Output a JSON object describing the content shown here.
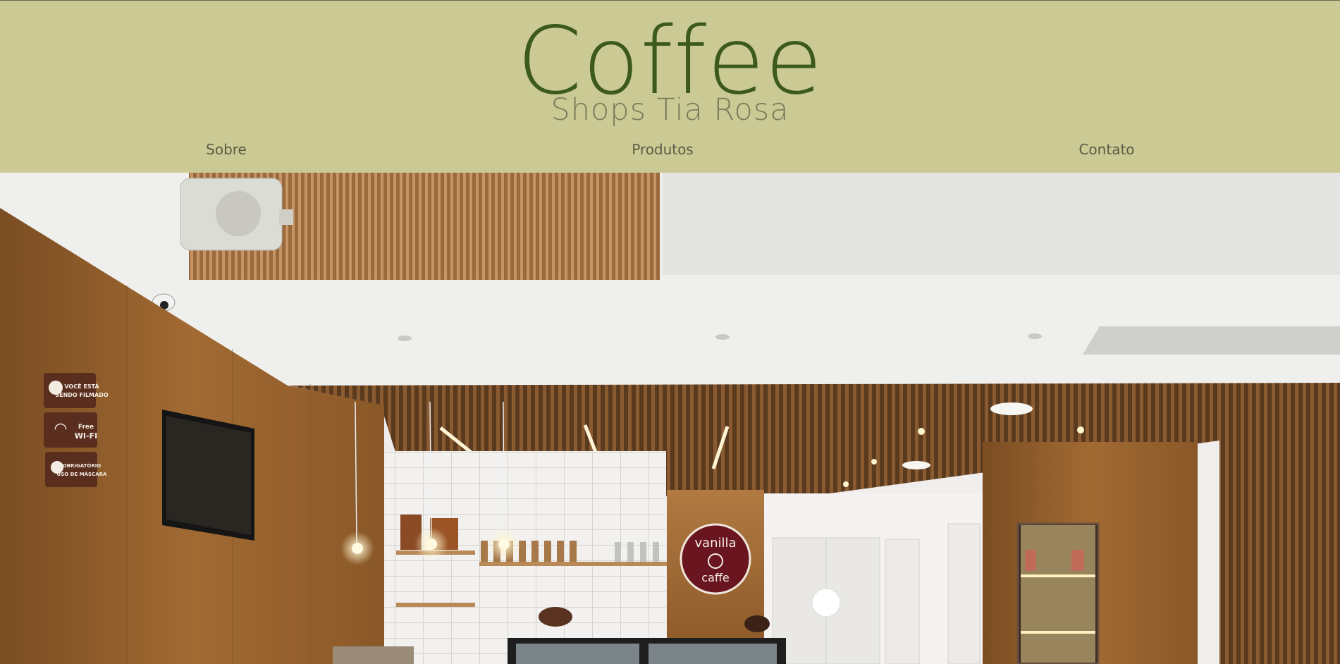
{
  "brand": {
    "title": "Coffee",
    "subtitle": "Shops Tia Rosa",
    "title_color": "#3d5a1e",
    "subtitle_color": "#7b7a5a",
    "header_bg": "#cbca94"
  },
  "nav": {
    "items": [
      {
        "label": "Sobre"
      },
      {
        "label": "Produtos"
      },
      {
        "label": "Contato"
      }
    ]
  },
  "hero": {
    "signs": {
      "filming_line1": "VOCÊ ESTÁ",
      "filming_line2": "SENDO FILMADO",
      "wifi_line1": "Free",
      "wifi_line2": "WI-FI",
      "mask_line1": "OBRIGATÓRIO",
      "mask_line2": "USO DE MÁSCARA"
    },
    "cafe_logo": {
      "line1": "vanilla",
      "line2": "caffe"
    }
  }
}
